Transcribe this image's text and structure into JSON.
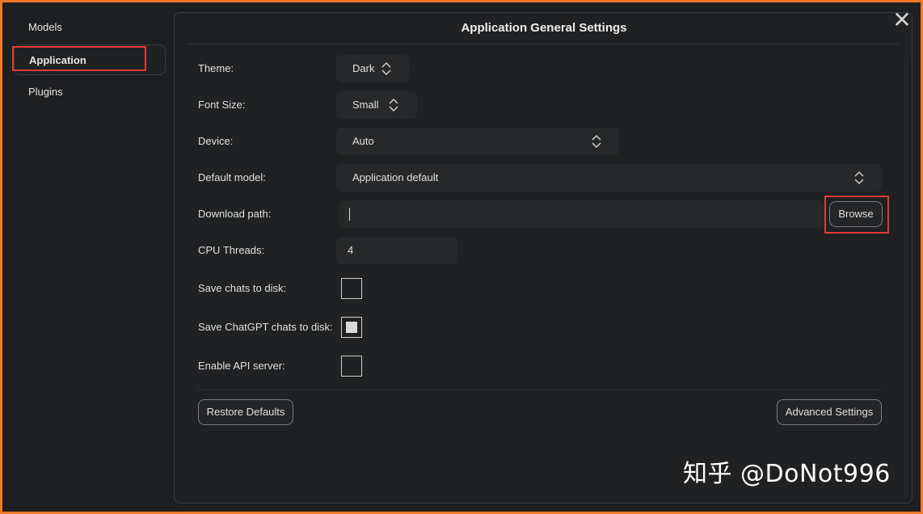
{
  "sidebar": {
    "items": [
      {
        "label": "Models",
        "active": false
      },
      {
        "label": "Application",
        "active": true
      },
      {
        "label": "Plugins",
        "active": false
      }
    ]
  },
  "panel": {
    "title": "Application General Settings",
    "close_icon": "close-icon"
  },
  "settings": {
    "theme": {
      "label": "Theme:",
      "value": "Dark"
    },
    "font_size": {
      "label": "Font Size:",
      "value": "Small"
    },
    "device": {
      "label": "Device:",
      "value": "Auto"
    },
    "default_model": {
      "label": "Default model:",
      "value": "Application default"
    },
    "download_path": {
      "label": "Download path:",
      "value": "",
      "browse_label": "Browse"
    },
    "cpu_threads": {
      "label": "CPU Threads:",
      "value": "4"
    },
    "save_chats": {
      "label": "Save chats to disk:",
      "checked": false
    },
    "save_chatgpt_chats": {
      "label": "Save ChatGPT chats to disk:",
      "checked": true
    },
    "enable_api_server": {
      "label": "Enable API server:",
      "checked": false
    }
  },
  "buttons": {
    "restore_defaults": "Restore Defaults",
    "advanced_settings": "Advanced Settings"
  },
  "watermark": "知乎 @DoNot996",
  "colors": {
    "background": "#1d1f21",
    "panel": "#1f2123",
    "field": "#262829",
    "text": "#e0e0e0",
    "highlight": "#e53935",
    "outer_border": "#f07a2a"
  }
}
